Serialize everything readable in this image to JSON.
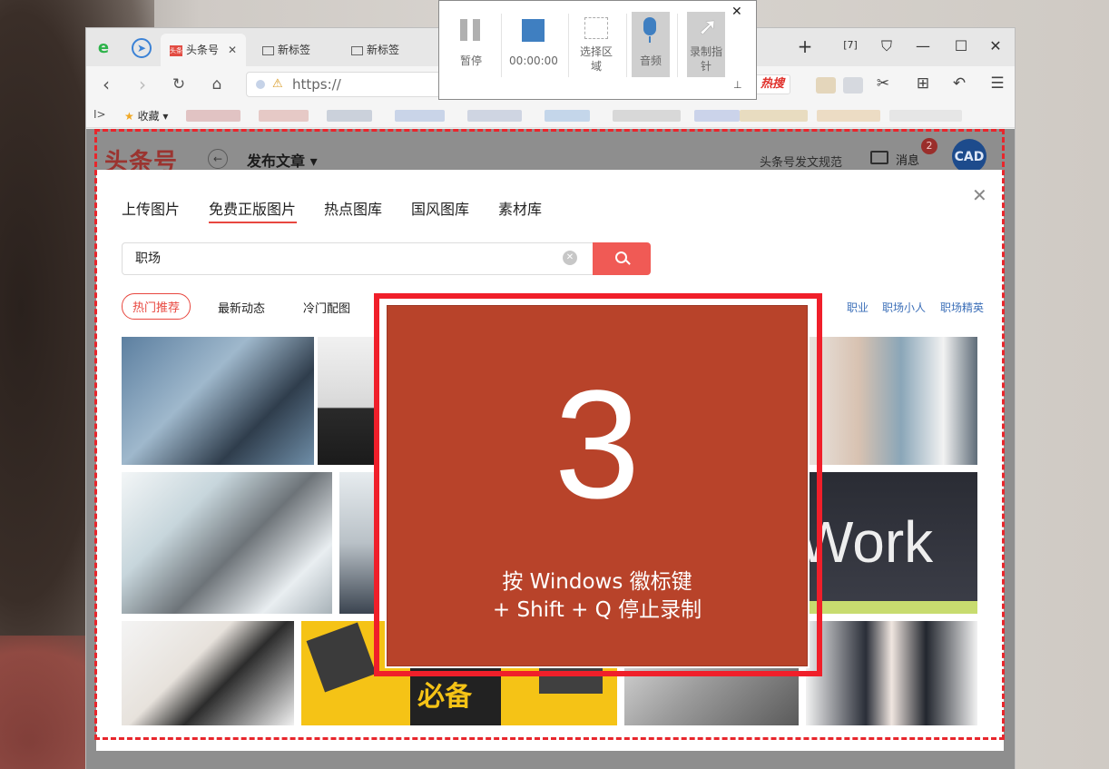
{
  "browser": {
    "tabs": [
      {
        "label": "头条号",
        "favicon": "头条"
      },
      {
        "label": "新标签"
      },
      {
        "label": "新标签"
      }
    ],
    "url": "https://",
    "hot_search": "热搜",
    "bookmarks_label": "收藏"
  },
  "page": {
    "brand": "头条号",
    "title": "发布文章 ▾",
    "guidelines_link": "头条号发文规范",
    "messages_label": "消息",
    "messages_count": "2",
    "avatar_text": "CAD"
  },
  "modal": {
    "tabs": [
      "上传图片",
      "免费正版图片",
      "热点图库",
      "国风图库",
      "素材库"
    ],
    "active_tab": 1,
    "search_value": "职场",
    "filters": [
      "热门推荐",
      "最新动态",
      "冷门配图"
    ],
    "keywords": [
      "职业",
      "职场小人",
      "职场精英"
    ]
  },
  "recorder": {
    "pause_label": "暂停",
    "timer": "00:00:00",
    "select_region_label": "选择区域",
    "audio_label": "音频",
    "cursor_label": "录制指针",
    "close": "✕"
  },
  "countdown": {
    "number": "3",
    "hint_line1": "按 Windows 徽标键",
    "hint_line2": "+ Shift + Q 停止录制",
    "background_color": "#b8432a"
  },
  "colors": {
    "accent_red": "#e8473f",
    "capture_border": "#e8262c",
    "link_blue": "#3c6fb8"
  }
}
